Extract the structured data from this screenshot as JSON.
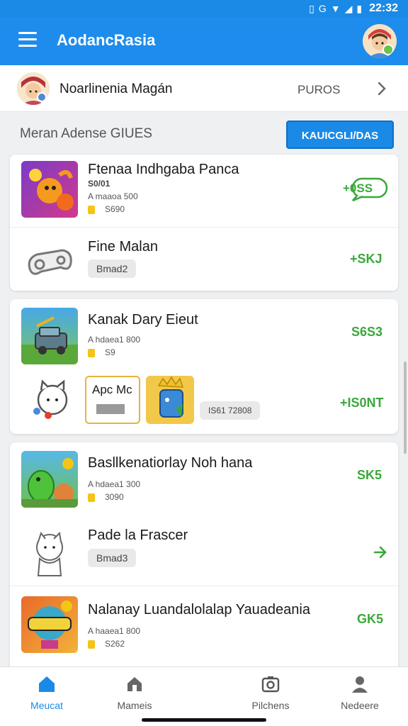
{
  "status_bar": {
    "time": "22:32"
  },
  "app_bar": {
    "title": "Aodanc⁠Rasia"
  },
  "profile": {
    "name": "Noarlinenia Magán",
    "status": "PUROS"
  },
  "section": {
    "title": "Meran Adense GIUES",
    "action_label": "KAUICGLI/DAS"
  },
  "cards": [
    {
      "rows": [
        {
          "title": "Ftenaa Indhgaba Panca",
          "sub": "S0/01",
          "meta": "A maaoa 500",
          "coins": "S690",
          "price": "+0SS"
        },
        {
          "title": "Fine Malan",
          "badge": "Bmad2",
          "price": "+SKJ"
        }
      ]
    },
    {
      "rows": [
        {
          "title": "Kanak Dary Eieut",
          "meta": "A hdaea1 800",
          "coins": "S9",
          "price": "S6S3"
        },
        {
          "title": "Apc Mc",
          "extra": "IS61 72808",
          "price": "+IS0NT"
        }
      ]
    },
    {
      "rows": [
        {
          "title": "Basllkenatiorlay Noh hana",
          "meta": "A hdaea1 300",
          "coins": "3090",
          "price": "SK5"
        },
        {
          "title": "Pade la Frascer",
          "badge": "Bmad3",
          "price": ""
        },
        {
          "title": "Nalanay Luandalolalap Yauadeania",
          "meta": "A haaea1 800",
          "coins": "S262",
          "price": "GK5"
        }
      ]
    }
  ],
  "nav": [
    {
      "label": "Meucat",
      "icon": "home-icon"
    },
    {
      "label": "Mameis",
      "icon": "house-icon"
    },
    {
      "label": "Pilchens",
      "icon": "camera-icon"
    },
    {
      "label": "Nedeere",
      "icon": "person-icon"
    }
  ],
  "colors": {
    "primary": "#1e8cec",
    "accent_green": "#3aa83a",
    "coin": "#f2c516"
  }
}
